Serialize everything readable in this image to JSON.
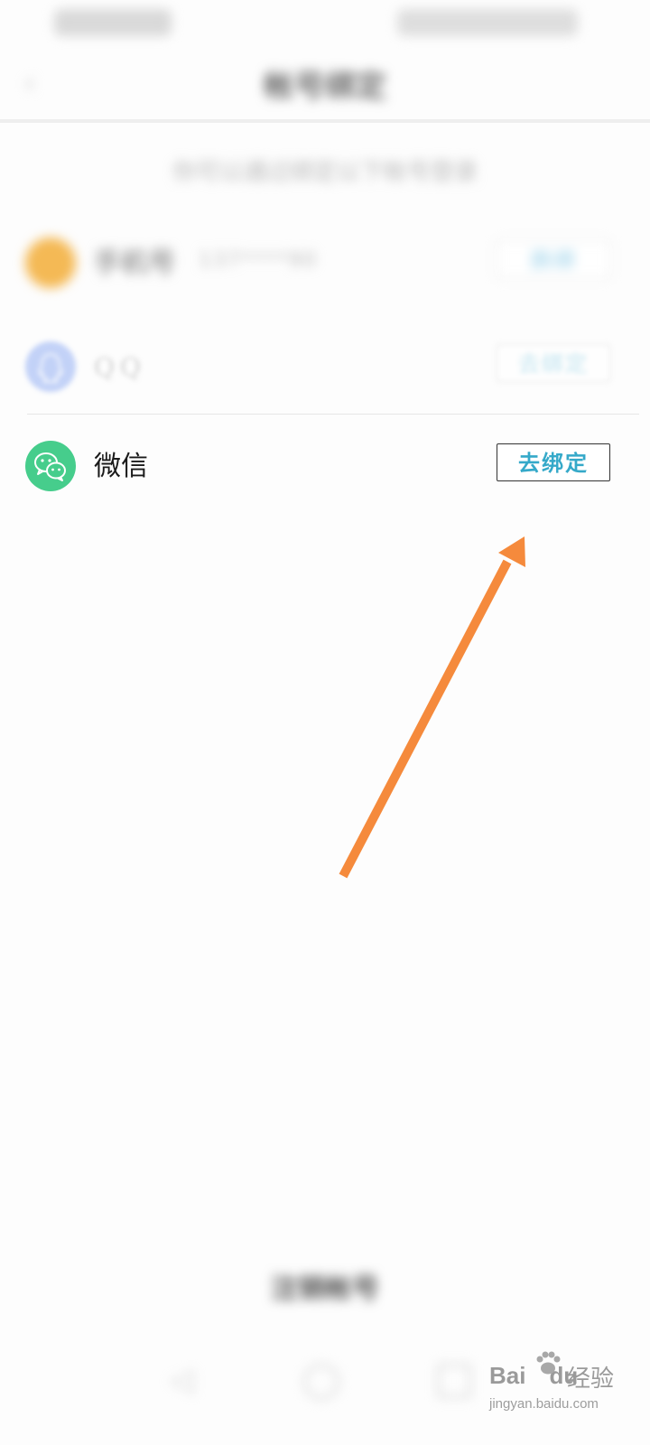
{
  "header": {
    "title": "帐号绑定"
  },
  "hint": "你可以通过绑定以下帐号登录",
  "accounts": [
    {
      "name": "手机号",
      "detail": "137****90",
      "action_label": "换绑"
    },
    {
      "name": "QQ",
      "action_label": "去绑定"
    },
    {
      "name": "微信",
      "action_label": "去绑定"
    }
  ],
  "footer": {
    "logout_label": "注销帐号"
  },
  "watermark": {
    "brand": "Bai",
    "brand_suffix": "du",
    "product": "经验",
    "url": "jingyan.baidu.com"
  },
  "colors": {
    "accent": "#35a9c9",
    "wechat": "#46cd8c",
    "qq": "#93aff3",
    "phone": "#f4b955",
    "arrow": "#f58a3c"
  },
  "icons": {
    "back": "back-arrow-icon",
    "wechat": "wechat-icon",
    "qq": "qq-penguin-icon",
    "phone": "phone-icon"
  }
}
